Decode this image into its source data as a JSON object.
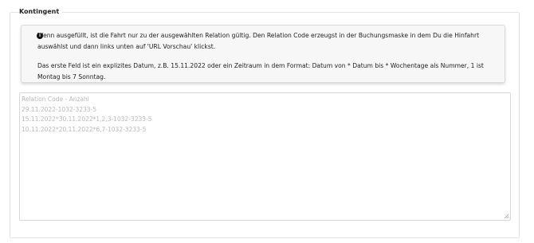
{
  "section": {
    "title": "Kontingent"
  },
  "info": {
    "icon": "info-circle-icon",
    "line1": "Wenn ausgefüllt, ist die Fahrt nur zu der ausgewählten Relation gültig. Den Relation Code erzeugst in der Buchungsmaske in dem Du die Hinfahrt auswählst und dann links unten auf 'URL Vorschau' klickst.",
    "line2": "Das erste Feld ist ein explizites Datum, z.B. 15.11.2022 oder ein Zeitraum in dem Format: Datum von * Datum bis * Wochentage als Nummer, 1 ist Montag bis 7 Sonntag."
  },
  "textarea": {
    "placeholder_lines": [
      "Relation Code - Anzahl",
      "29.11.2022-1032-3233-5",
      "15.11.2022*30.11.2022*1,2,3-1032-3233-5",
      "10.11.2022*20.11.2022*6,7-1032-3233-5"
    ]
  }
}
